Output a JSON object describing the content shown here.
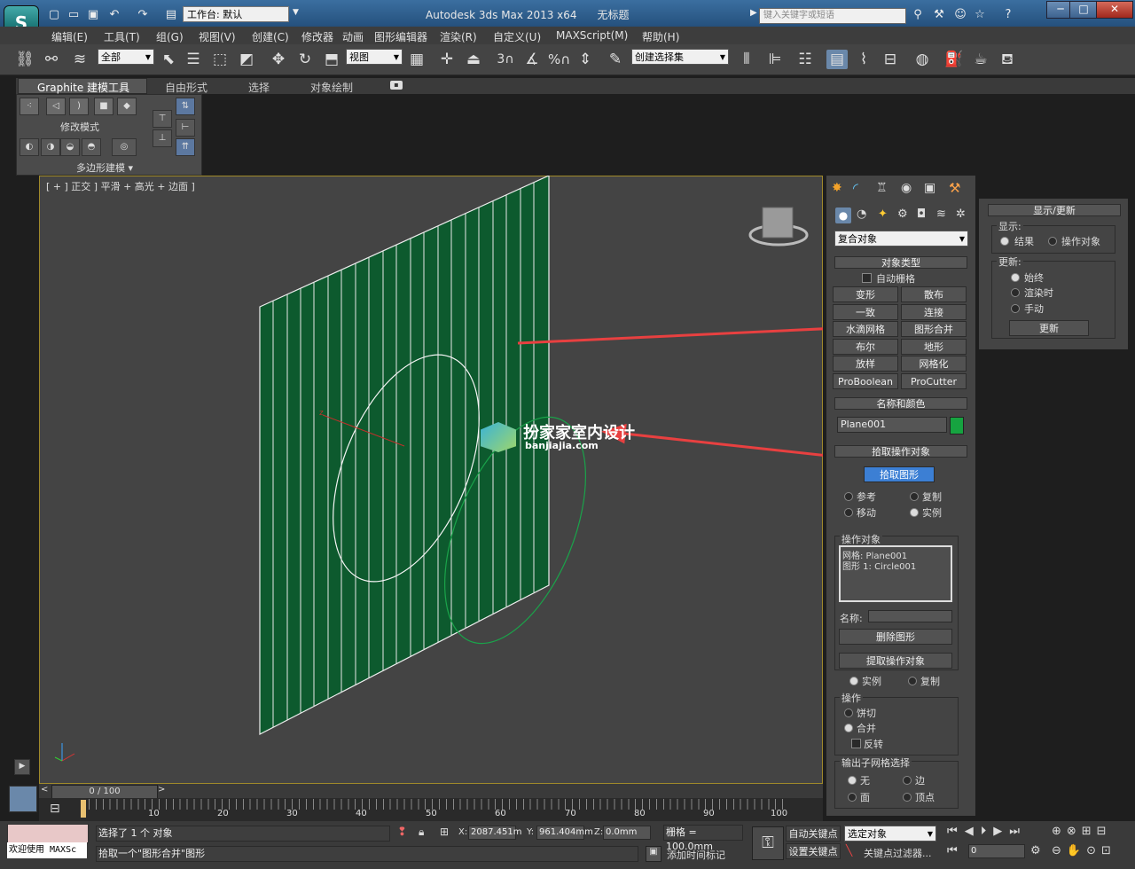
{
  "titlebar": {
    "workspace": "工作台: 默认",
    "window_title": "Autodesk 3ds Max  2013 x64",
    "doc_title": "无标题",
    "search_placeholder": "键入关键字或短语"
  },
  "menu": [
    "编辑(E)",
    "工具(T)",
    "组(G)",
    "视图(V)",
    "创建(C)",
    "修改器",
    "动画",
    "图形编辑器",
    "渲染(R)",
    "自定义(U)",
    "MAXScript(M)",
    "帮助(H)"
  ],
  "toolbar": {
    "selection_filter": "全部",
    "ref_coord": "视图",
    "named_selection": "创建选择集"
  },
  "ribbon": {
    "tabs": [
      "Graphite 建模工具",
      "自由形式",
      "选择",
      "对象绘制"
    ],
    "panel_label": "修改模式",
    "footer": "多边形建模"
  },
  "viewport": {
    "label": "[ + ] 正交 ] 平滑 + 高光 + 边面 ]",
    "plane_color": "#0d5a2e",
    "watermark_title": "扮家家室内设计",
    "watermark_url": "banjiajia.com"
  },
  "command_panel": {
    "category": "复合对象",
    "object_type": {
      "title": "对象类型",
      "autogrid": "自动栅格",
      "buttons": [
        "变形",
        "散布",
        "一致",
        "连接",
        "水滴网格",
        "图形合并",
        "布尔",
        "地形",
        "放样",
        "网格化",
        "ProBoolean",
        "ProCutter"
      ]
    },
    "name_color": {
      "title": "名称和颜色",
      "name": "Plane001",
      "color": "#16a340"
    },
    "pick": {
      "title": "拾取操作对象",
      "button": "拾取图形",
      "options": [
        "参考",
        "复制",
        "移动",
        "实例"
      ]
    },
    "operands": {
      "title": "操作对象",
      "items": [
        "网格: Plane001",
        "图形 1: Circle001"
      ],
      "name_label": "名称:",
      "delete_btn": "删除图形",
      "extract_btn": "提取操作对象",
      "mode": [
        "实例",
        "复制"
      ]
    },
    "operation": {
      "title": "操作",
      "items": [
        "饼切",
        "合并"
      ],
      "invert": "反转"
    },
    "output": {
      "title": "输出子网格选择",
      "items": [
        "无",
        "边",
        "面",
        "顶点"
      ]
    }
  },
  "display_panel": {
    "title": "显示/更新",
    "display_label": "显示:",
    "display_opts": [
      "结果",
      "操作对象"
    ],
    "update_label": "更新:",
    "update_opts": [
      "始终",
      "渲染时",
      "手动"
    ],
    "update_btn": "更新"
  },
  "timeline": {
    "frame": "0 / 100",
    "ticks": [
      "10",
      "20",
      "30",
      "40",
      "50",
      "60",
      "70",
      "80",
      "90",
      "100"
    ]
  },
  "status": {
    "welcome": "欢迎使用 MAXSc",
    "selected": "选择了 1 个 对象",
    "prompt": "拾取一个\"图形合并\"图形",
    "x": "2087.451m",
    "y": "961.404mm",
    "z": "0.0mm",
    "grid": "栅格 = 100.0mm",
    "add_time_tag": "添加时间标记",
    "auto_key": "自动关键点",
    "set_key": "设置关键点",
    "key_mode": "选定对象",
    "key_filters": "关键点过滤器...",
    "frame": "0"
  }
}
